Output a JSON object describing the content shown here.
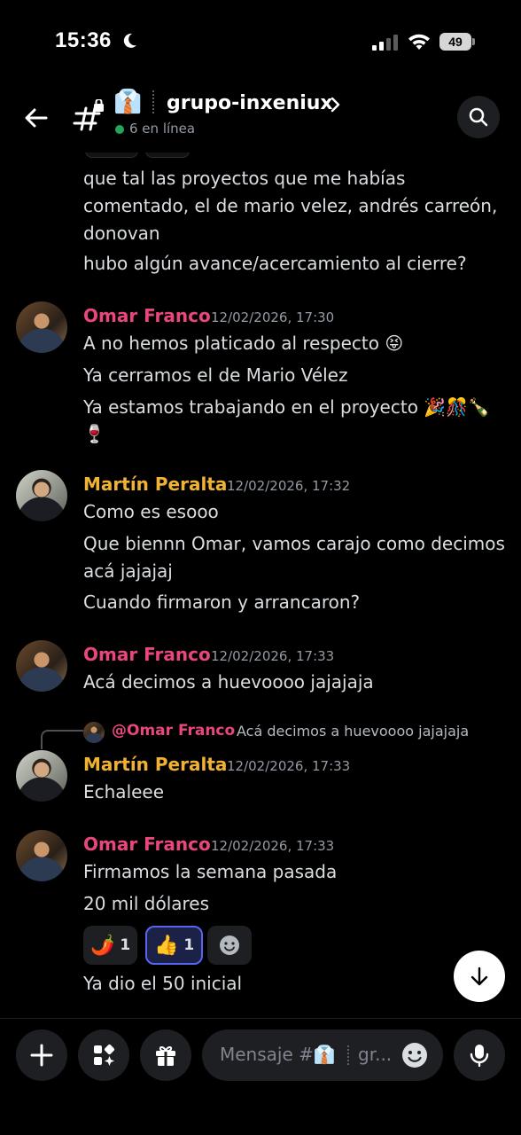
{
  "status_bar": {
    "time": "15:36",
    "battery": "49",
    "icons": [
      "moon-icon",
      "signal-icon",
      "wifi-icon",
      "battery-icon"
    ]
  },
  "header": {
    "channel_emoji": "👔",
    "channel_name": "grupo-inxeniux",
    "online_text": "6 en línea",
    "online_color": "#23a55a"
  },
  "messages": {
    "continuation": {
      "lines": [
        "que tal las proyectos que me habías",
        "comentado, el de mario velez, andrés carreón,",
        "donovan",
        "hubo algún avance/acercamiento al cierre?"
      ]
    },
    "m1": {
      "author": "Omar Franco",
      "timestamp": "12/02/2026, 17:30",
      "lines": [
        "A no hemos platicado al respecto 😝",
        "Ya cerramos el de Mario Vélez",
        "Ya estamos trabajando en el proyecto 🎉🎊🍾",
        "🍷"
      ]
    },
    "m2": {
      "author": "Martín Peralta",
      "timestamp": "12/02/2026, 17:32",
      "lines": [
        "Como es esooo",
        "Que biennn Omar, vamos carajo como decimos",
        "acá jajajaj",
        "Cuando firmaron y arrancaron?"
      ]
    },
    "m3": {
      "author": "Omar Franco",
      "timestamp": "12/02/2026, 17:33",
      "lines": [
        "Acá decimos a huevoooo jajajaja"
      ]
    },
    "m4": {
      "reply_author": "@Omar Franco",
      "reply_text": "Acá decimos a huevoooo jajajaja",
      "author": "Martín Peralta",
      "timestamp": "12/02/2026, 17:33",
      "lines": [
        "Echaleee"
      ]
    },
    "m5": {
      "author": "Omar Franco",
      "timestamp": "12/02/2026, 17:33",
      "lines": [
        "Firmamos la semana pasada",
        "20 mil dólares"
      ],
      "reactions": [
        {
          "emoji": "🌶️",
          "count": "1",
          "active": false
        },
        {
          "emoji": "👍",
          "count": "1",
          "active": true
        }
      ],
      "after_lines": [
        "Ya dio el 50 inicial"
      ]
    }
  },
  "composer": {
    "placeholder": "Mensaje #👔",
    "placeholder_tail": "gr..."
  },
  "colors": {
    "omar": "#e8467c",
    "martin": "#f0b232",
    "accent": "#5865f2"
  }
}
